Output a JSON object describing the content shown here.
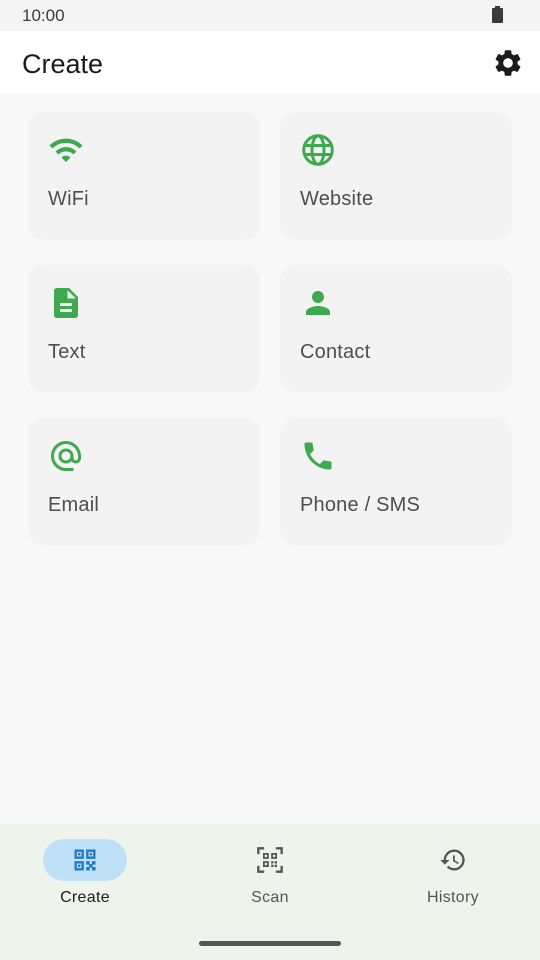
{
  "status_bar": {
    "time": "10:00",
    "battery_icon": "battery-icon"
  },
  "app_bar": {
    "title": "Create",
    "settings_icon": "gear-icon"
  },
  "colors": {
    "accent_green": "#3daa4d",
    "nav_active": "#1e7bc6",
    "nav_pill": "#bfe1f8",
    "nav_bg": "#eef4ec"
  },
  "cards": [
    {
      "label": "WiFi",
      "icon": "wifi-icon"
    },
    {
      "label": "Website",
      "icon": "globe-icon"
    },
    {
      "label": "Text",
      "icon": "document-icon"
    },
    {
      "label": "Contact",
      "icon": "person-icon"
    },
    {
      "label": "Email",
      "icon": "at-sign-icon"
    },
    {
      "label": "Phone / SMS",
      "icon": "phone-icon"
    }
  ],
  "nav": [
    {
      "label": "Create",
      "icon": "qr-code-icon",
      "active": true
    },
    {
      "label": "Scan",
      "icon": "qr-scan-icon",
      "active": false
    },
    {
      "label": "History",
      "icon": "history-icon",
      "active": false
    }
  ]
}
